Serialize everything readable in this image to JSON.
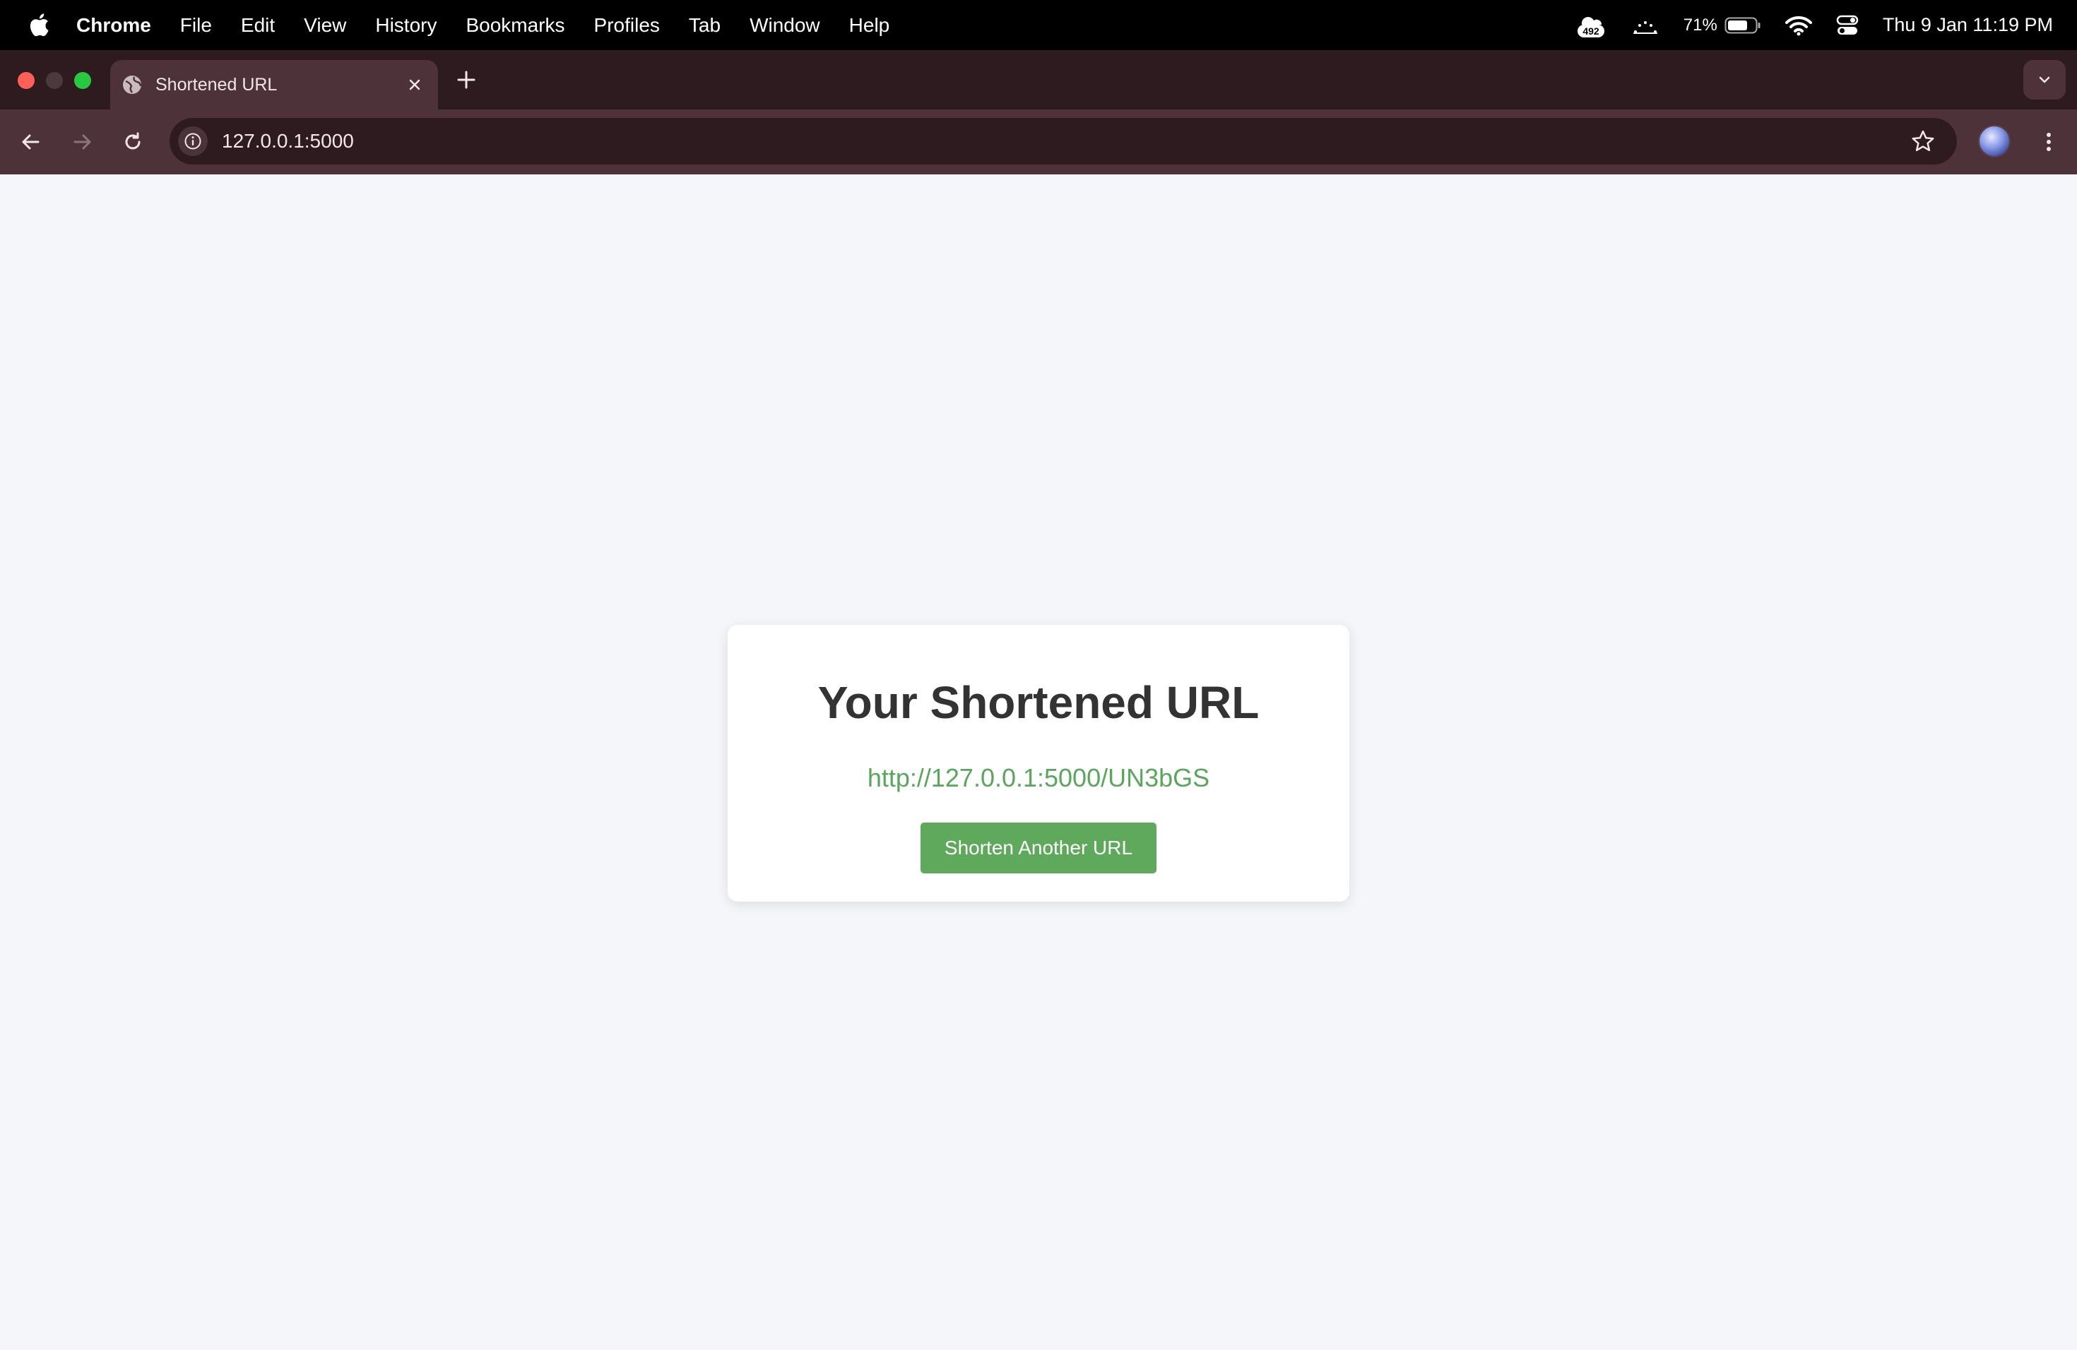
{
  "menubar": {
    "app_name": "Chrome",
    "items": [
      "File",
      "Edit",
      "View",
      "History",
      "Bookmarks",
      "Profiles",
      "Tab",
      "Window",
      "Help"
    ],
    "status": {
      "badge_count": "492",
      "battery_percent": "71%",
      "datetime": "Thu 9 Jan  11:19 PM"
    }
  },
  "browser": {
    "tab": {
      "title": "Shortened URL"
    },
    "address_bar": {
      "url": "127.0.0.1:5000"
    }
  },
  "page": {
    "heading": "Your Shortened URL",
    "short_url": "http://127.0.0.1:5000/UN3bGS",
    "button_label": "Shorten Another URL"
  },
  "colors": {
    "accent_green": "#5fa95d",
    "link_green": "#5aa65c",
    "browser_frame": "#2e1b20",
    "toolbar": "#4e323a",
    "page_bg": "#f5f6fa"
  }
}
